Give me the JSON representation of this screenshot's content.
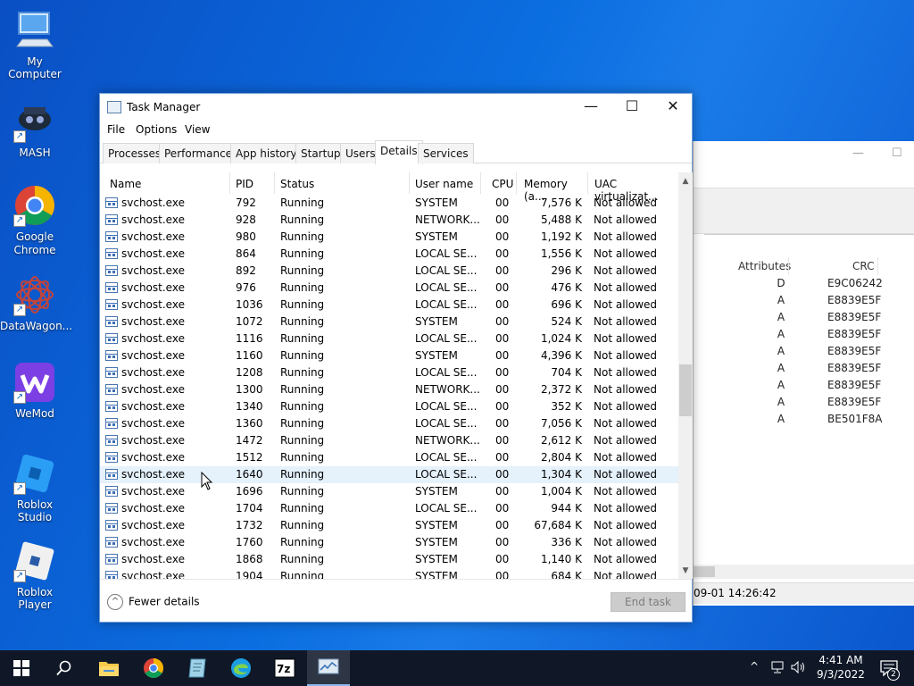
{
  "desktop": {
    "icons": [
      {
        "label": "My Computer",
        "icon": "computer-icon"
      },
      {
        "label": "MASH",
        "icon": "mash-icon"
      },
      {
        "label": "Google Chrome",
        "icon": "chrome-icon"
      },
      {
        "label": "DataWagon...",
        "icon": "datawagon-icon"
      },
      {
        "label": "WeMod",
        "icon": "wemod-icon"
      },
      {
        "label": "Roblox Studio",
        "icon": "roblox-studio-icon"
      },
      {
        "label": "Roblox Player",
        "icon": "roblox-player-icon"
      }
    ]
  },
  "bg_window": {
    "headers": {
      "attributes": "Attributes",
      "crc": "CRC"
    },
    "rows": [
      {
        "attr": "D",
        "crc": "E9C06242"
      },
      {
        "attr": "A",
        "crc": "E8839E5F"
      },
      {
        "attr": "A",
        "crc": "E8839E5F"
      },
      {
        "attr": "A",
        "crc": "E8839E5F"
      },
      {
        "attr": "A",
        "crc": "E8839E5F"
      },
      {
        "attr": "A",
        "crc": "E8839E5F"
      },
      {
        "attr": "A",
        "crc": "E8839E5F"
      },
      {
        "attr": "A",
        "crc": "E8839E5F"
      },
      {
        "attr": "A",
        "crc": "BE501F8A"
      }
    ],
    "status": "09-01 14:26:42"
  },
  "task_manager": {
    "title": "Task Manager",
    "menu": [
      "File",
      "Options",
      "View"
    ],
    "tabs": [
      "Processes",
      "Performance",
      "App history",
      "Startup",
      "Users",
      "Details",
      "Services"
    ],
    "active_tab": "Details",
    "columns": [
      "Name",
      "PID",
      "Status",
      "User name",
      "CPU",
      "Memory (a...",
      "UAC virtualizat..."
    ],
    "rows": [
      {
        "name": "svchost.exe",
        "pid": "792",
        "status": "Running",
        "user": "SYSTEM",
        "cpu": "00",
        "mem": "7,576 K",
        "uac": "Not allowed"
      },
      {
        "name": "svchost.exe",
        "pid": "928",
        "status": "Running",
        "user": "NETWORK...",
        "cpu": "00",
        "mem": "5,488 K",
        "uac": "Not allowed"
      },
      {
        "name": "svchost.exe",
        "pid": "980",
        "status": "Running",
        "user": "SYSTEM",
        "cpu": "00",
        "mem": "1,192 K",
        "uac": "Not allowed"
      },
      {
        "name": "svchost.exe",
        "pid": "864",
        "status": "Running",
        "user": "LOCAL SE...",
        "cpu": "00",
        "mem": "1,556 K",
        "uac": "Not allowed"
      },
      {
        "name": "svchost.exe",
        "pid": "892",
        "status": "Running",
        "user": "LOCAL SE...",
        "cpu": "00",
        "mem": "296 K",
        "uac": "Not allowed"
      },
      {
        "name": "svchost.exe",
        "pid": "976",
        "status": "Running",
        "user": "LOCAL SE...",
        "cpu": "00",
        "mem": "476 K",
        "uac": "Not allowed"
      },
      {
        "name": "svchost.exe",
        "pid": "1036",
        "status": "Running",
        "user": "LOCAL SE...",
        "cpu": "00",
        "mem": "696 K",
        "uac": "Not allowed"
      },
      {
        "name": "svchost.exe",
        "pid": "1072",
        "status": "Running",
        "user": "SYSTEM",
        "cpu": "00",
        "mem": "524 K",
        "uac": "Not allowed"
      },
      {
        "name": "svchost.exe",
        "pid": "1116",
        "status": "Running",
        "user": "LOCAL SE...",
        "cpu": "00",
        "mem": "1,024 K",
        "uac": "Not allowed"
      },
      {
        "name": "svchost.exe",
        "pid": "1160",
        "status": "Running",
        "user": "SYSTEM",
        "cpu": "00",
        "mem": "4,396 K",
        "uac": "Not allowed"
      },
      {
        "name": "svchost.exe",
        "pid": "1208",
        "status": "Running",
        "user": "LOCAL SE...",
        "cpu": "00",
        "mem": "704 K",
        "uac": "Not allowed"
      },
      {
        "name": "svchost.exe",
        "pid": "1300",
        "status": "Running",
        "user": "NETWORK...",
        "cpu": "00",
        "mem": "2,372 K",
        "uac": "Not allowed"
      },
      {
        "name": "svchost.exe",
        "pid": "1340",
        "status": "Running",
        "user": "LOCAL SE...",
        "cpu": "00",
        "mem": "352 K",
        "uac": "Not allowed"
      },
      {
        "name": "svchost.exe",
        "pid": "1360",
        "status": "Running",
        "user": "LOCAL SE...",
        "cpu": "00",
        "mem": "7,056 K",
        "uac": "Not allowed"
      },
      {
        "name": "svchost.exe",
        "pid": "1472",
        "status": "Running",
        "user": "NETWORK...",
        "cpu": "00",
        "mem": "2,612 K",
        "uac": "Not allowed"
      },
      {
        "name": "svchost.exe",
        "pid": "1512",
        "status": "Running",
        "user": "LOCAL SE...",
        "cpu": "00",
        "mem": "2,804 K",
        "uac": "Not allowed"
      },
      {
        "name": "svchost.exe",
        "pid": "1640",
        "status": "Running",
        "user": "LOCAL SE...",
        "cpu": "00",
        "mem": "1,304 K",
        "uac": "Not allowed"
      },
      {
        "name": "svchost.exe",
        "pid": "1696",
        "status": "Running",
        "user": "SYSTEM",
        "cpu": "00",
        "mem": "1,004 K",
        "uac": "Not allowed"
      },
      {
        "name": "svchost.exe",
        "pid": "1704",
        "status": "Running",
        "user": "LOCAL SE...",
        "cpu": "00",
        "mem": "944 K",
        "uac": "Not allowed"
      },
      {
        "name": "svchost.exe",
        "pid": "1732",
        "status": "Running",
        "user": "SYSTEM",
        "cpu": "00",
        "mem": "67,684 K",
        "uac": "Not allowed"
      },
      {
        "name": "svchost.exe",
        "pid": "1760",
        "status": "Running",
        "user": "SYSTEM",
        "cpu": "00",
        "mem": "336 K",
        "uac": "Not allowed"
      },
      {
        "name": "svchost.exe",
        "pid": "1868",
        "status": "Running",
        "user": "SYSTEM",
        "cpu": "00",
        "mem": "1,140 K",
        "uac": "Not allowed"
      },
      {
        "name": "svchost.exe",
        "pid": "1904",
        "status": "Running",
        "user": "SYSTEM",
        "cpu": "00",
        "mem": "684 K",
        "uac": "Not allowed"
      }
    ],
    "highlighted_pid": "1640",
    "fewer_details": "Fewer details",
    "end_task": "End task"
  },
  "taskbar": {
    "items": [
      "start-icon",
      "search-icon",
      "file-explorer-icon",
      "chrome-icon",
      "notepad-icon",
      "edge-icon",
      "7zip-icon",
      "task-manager-icon"
    ],
    "active": "task-manager-icon",
    "time": "4:41 AM",
    "date": "9/3/2022",
    "notifications": "2"
  },
  "colors": {
    "desktop": "#0b6ee0",
    "taskbar": "#101828",
    "selection": "#e5f1fb"
  }
}
